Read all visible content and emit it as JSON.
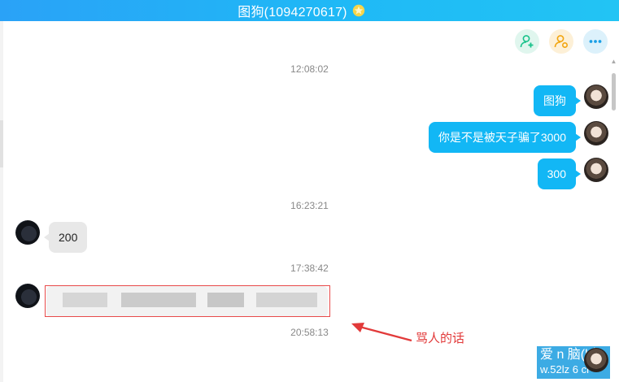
{
  "window": {
    "title": "图狗(1094270617)"
  },
  "toolbar": {
    "add_member_icon": "user-add-icon",
    "user_icon": "user-settings-icon",
    "more_icon": "more-icon"
  },
  "messages": {
    "t1": "12:08:02",
    "m1": "图狗",
    "m2": "你是不是被天子骗了3000",
    "m3": "300",
    "t2": "16:23:21",
    "m4": "200",
    "t3": "17:38:42",
    "t4": "20:58:13"
  },
  "annotation": {
    "label": "骂人的话"
  },
  "watermark": {
    "line1": "爱 n 脑(l小",
    "line2": "w.52lz 6 ci"
  },
  "colors": {
    "accent": "#12b7f5",
    "title_bar": "#22b0f6",
    "annotation": "#e23a3a"
  }
}
